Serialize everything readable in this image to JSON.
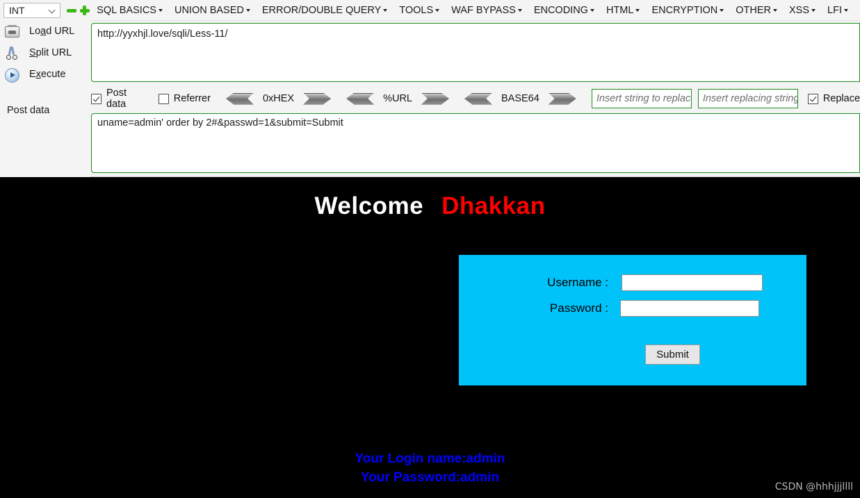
{
  "hackbar": {
    "type_selector": {
      "value": "INT",
      "icon": "chevron-down-icon"
    },
    "minus_icon": "minus-icon",
    "plus_icon": "plus-icon",
    "menus": [
      {
        "label": "SQL BASICS"
      },
      {
        "label": "UNION BASED"
      },
      {
        "label": "ERROR/DOUBLE QUERY"
      },
      {
        "label": "TOOLS"
      },
      {
        "label": "WAF BYPASS"
      },
      {
        "label": "ENCODING"
      },
      {
        "label": "HTML"
      },
      {
        "label": "ENCRYPTION"
      },
      {
        "label": "OTHER"
      },
      {
        "label": "XSS"
      },
      {
        "label": "LFI"
      }
    ],
    "tools": [
      {
        "label_pre": "Lo",
        "label_key": "a",
        "label_post": "d URL",
        "icon": "load-url-icon"
      },
      {
        "label_pre": "",
        "label_key": "S",
        "label_post": "plit URL",
        "icon": "scissors-icon"
      },
      {
        "label_pre": "E",
        "label_key": "x",
        "label_post": "ecute",
        "icon": "play-icon"
      }
    ],
    "post_data_label": "Post data",
    "url_value": "http://yyxhjl.love/sqli/Less-11/",
    "options": {
      "post_data": {
        "label": "Post data",
        "checked": true
      },
      "referrer": {
        "label": "Referrer",
        "checked": false
      },
      "hex": {
        "label": "0xHEX"
      },
      "url_encode": {
        "label": "%URL"
      },
      "base64": {
        "label": "BASE64"
      },
      "replace_from_placeholder": "Insert string to replace",
      "replace_to_placeholder": "Insert replacing string",
      "replace": {
        "label": "Replace",
        "checked": true
      }
    },
    "post_data_value": "uname=admin' order by 2#&passwd=1&submit=Submit"
  },
  "page": {
    "welcome_text": "Welcome",
    "welcome_name": "Dhakkan",
    "form": {
      "username_label": "Username :",
      "username_value": "",
      "password_label": "Password :",
      "password_value": "",
      "submit_label": "Submit"
    },
    "result_line1": "Your Login name:admin",
    "result_line2": "Your Password:admin",
    "watermark": "CSDN @hhhjjjllll"
  },
  "colors": {
    "accent_green": "#1c8b1c",
    "form_cyan": "#00c3fa",
    "name_red": "#ff0000",
    "result_blue": "#0000ff",
    "page_black": "#000000"
  }
}
